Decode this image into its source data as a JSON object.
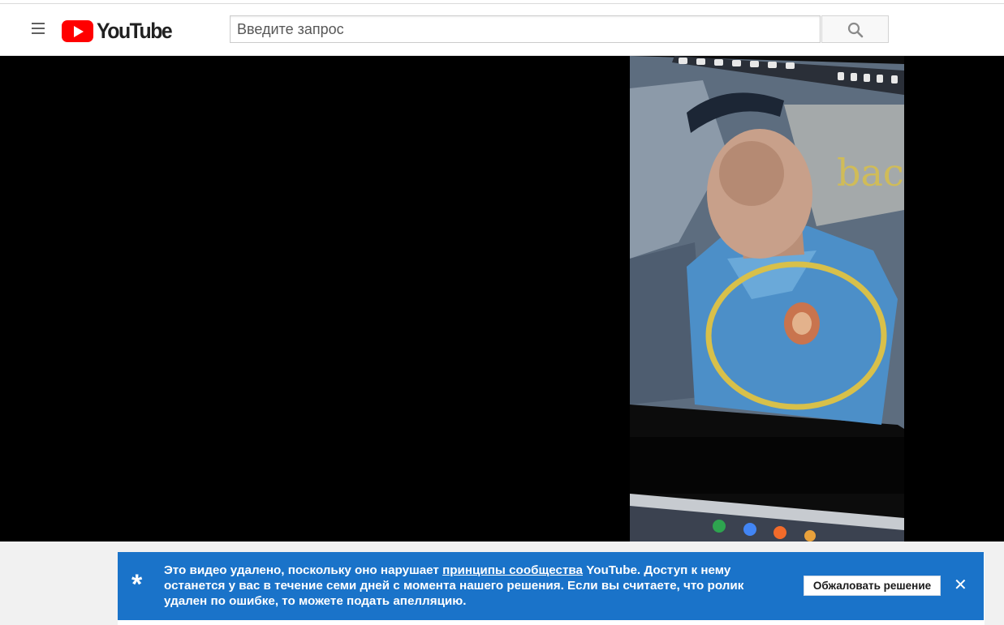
{
  "header": {
    "logo_text": "YouTube",
    "search_placeholder": "Введите запрос"
  },
  "video_frame": {
    "overlay_text": "bac",
    "accent_color": "#d8c04a"
  },
  "notice": {
    "icon": "asterisk-icon",
    "text_before": "Это видео удалено, поскольку оно нарушает ",
    "link": "принципы сообщества",
    "text_after": " YouTube. Доступ к нему останется у вас в течение семи дней с момента нашего решения. Если вы считаете, что ролик удален по ошибке, то можете подать апелляцию.",
    "appeal_button": "Обжаловать решение",
    "close": "✕",
    "background": "#1a73c9"
  }
}
